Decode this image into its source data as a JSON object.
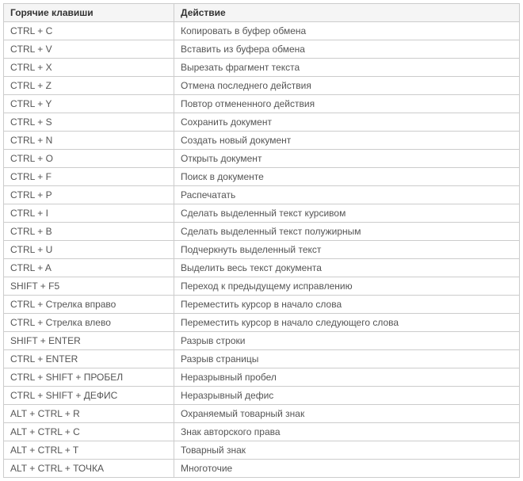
{
  "table": {
    "headers": {
      "key": "Горячие клавиши",
      "action": "Действие"
    },
    "rows": [
      {
        "key": "CTRL + C",
        "action": "Копировать в буфер обмена"
      },
      {
        "key": "CTRL + V",
        "action": "Вставить из буфера обмена"
      },
      {
        "key": "CTRL + X",
        "action": "Вырезать фрагмент текста"
      },
      {
        "key": "CTRL + Z",
        "action": "Отмена последнего действия"
      },
      {
        "key": "CTRL + Y",
        "action": "Повтор отмененного действия"
      },
      {
        "key": "CTRL + S",
        "action": "Сохранить документ"
      },
      {
        "key": "CTRL + N",
        "action": "Создать новый документ"
      },
      {
        "key": "CTRL + O",
        "action": "Открыть документ"
      },
      {
        "key": "CTRL + F",
        "action": "Поиск в документе"
      },
      {
        "key": "CTRL + P",
        "action": "Распечатать"
      },
      {
        "key": "CTRL + I",
        "action": "Сделать выделенный текст курсивом"
      },
      {
        "key": "CTRL + B",
        "action": "Сделать выделенный текст полужирным"
      },
      {
        "key": "CTRL + U",
        "action": "Подчеркнуть выделенный текст"
      },
      {
        "key": "CTRL + A",
        "action": "Выделить весь текст документа"
      },
      {
        "key": "SHIFT + F5",
        "action": "Переход к предыдущему исправлению"
      },
      {
        "key": "CTRL + Стрелка вправо",
        "action": "Переместить курсор в начало слова"
      },
      {
        "key": "CTRL + Стрелка влево",
        "action": "Переместить курсор в начало следующего слова"
      },
      {
        "key": "SHIFT + ENTER",
        "action": "Разрыв строки"
      },
      {
        "key": "CTRL + ENTER",
        "action": "Разрыв страницы"
      },
      {
        "key": "CTRL + SHIFT + ПРОБЕЛ",
        "action": "Неразрывный пробел"
      },
      {
        "key": "CTRL + SHIFT + ДЕФИС",
        "action": "Неразрывный дефис"
      },
      {
        "key": "ALT + CTRL + R",
        "action": "Охраняемый товарный знак"
      },
      {
        "key": "ALT + CTRL + C",
        "action": "Знак авторского права"
      },
      {
        "key": "ALT + CTRL + T",
        "action": "Товарный знак"
      },
      {
        "key": "ALT + CTRL + ТОЧКА",
        "action": "Многоточие"
      }
    ]
  }
}
